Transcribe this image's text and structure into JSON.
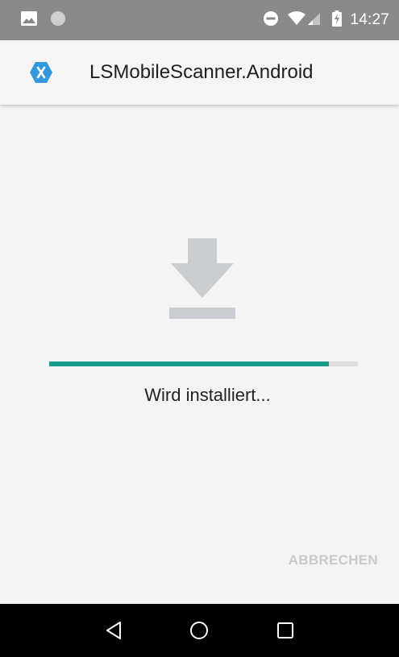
{
  "status_bar": {
    "time": "14:27",
    "icons_left": [
      "image-icon",
      "circle-notification-icon"
    ],
    "icons_right": [
      "do-not-disturb-icon",
      "wifi-icon",
      "signal-icon",
      "battery-charging-icon"
    ]
  },
  "app_bar": {
    "title": "LSMobileScanner.Android",
    "icon": "xamarin-logo-icon",
    "icon_color": "#3498db"
  },
  "install": {
    "icon": "download-icon",
    "progress": 0.905,
    "status_text": "Wird installiert...",
    "cancel_label": "ABBRECHEN",
    "accent_color": "#169c88"
  },
  "nav_bar": {
    "buttons": [
      "back-icon",
      "home-icon",
      "recents-icon"
    ]
  }
}
